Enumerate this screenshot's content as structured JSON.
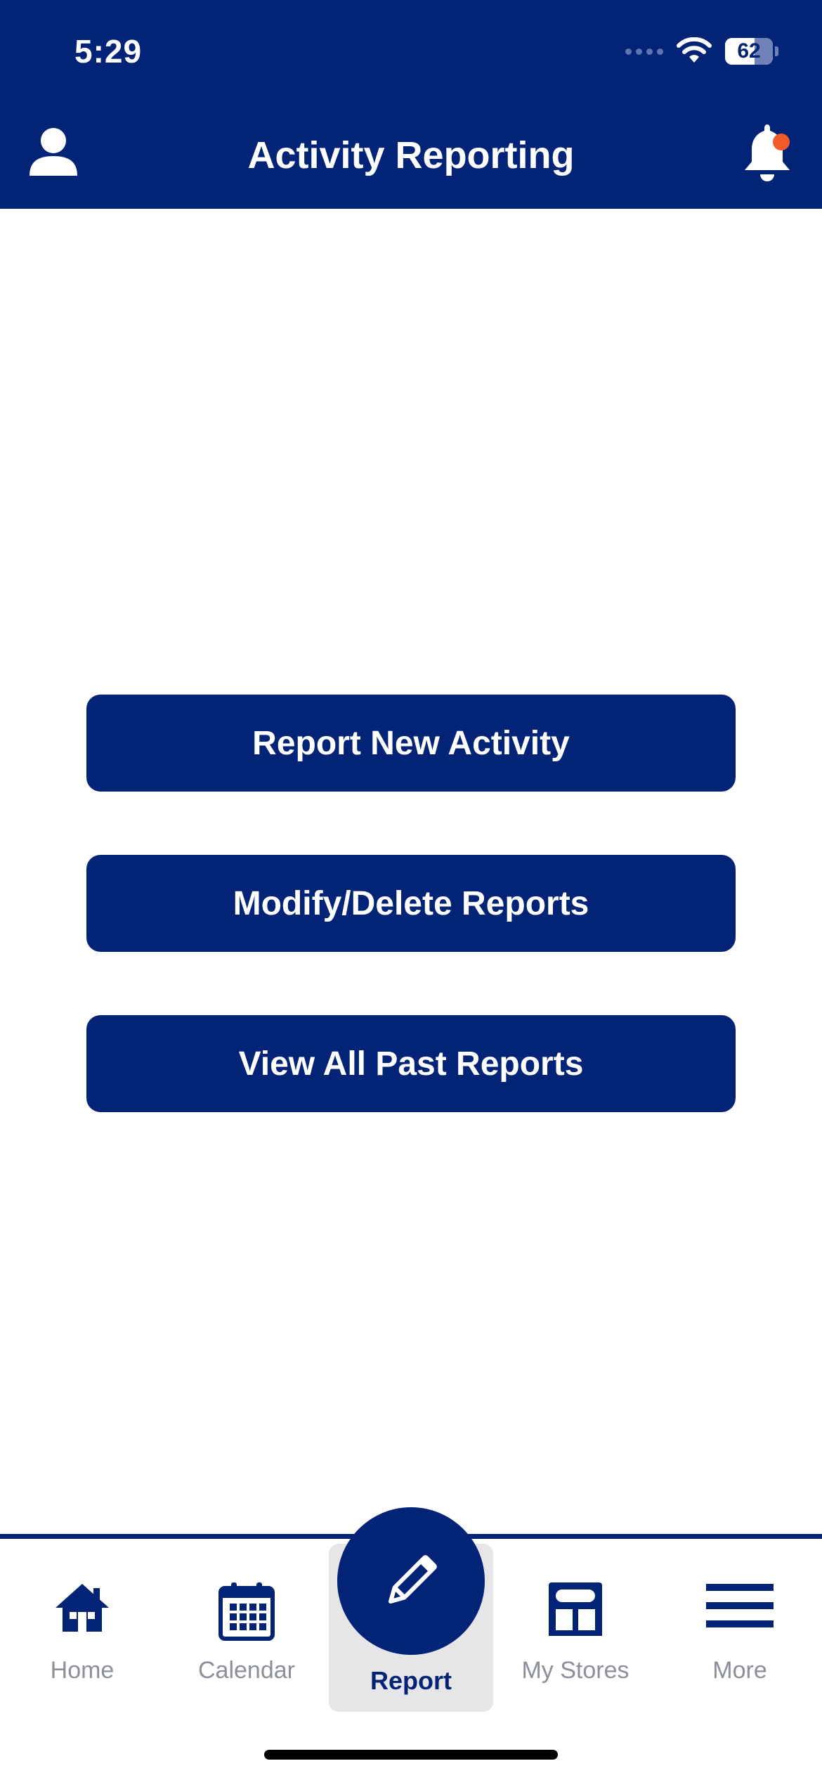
{
  "status_bar": {
    "time": "5:29",
    "battery_level": "62"
  },
  "header": {
    "title": "Activity Reporting",
    "notification_badge": true
  },
  "actions": {
    "report_new": "Report New Activity",
    "modify_delete": "Modify/Delete Reports",
    "view_past": "View All Past Reports"
  },
  "tabbar": {
    "items": [
      {
        "label": "Home",
        "icon": "home-icon"
      },
      {
        "label": "Calendar",
        "icon": "calendar-icon"
      },
      {
        "label": "Report",
        "icon": "pencil-icon",
        "active": true
      },
      {
        "label": "My Stores",
        "icon": "store-icon"
      },
      {
        "label": "More",
        "icon": "menu-icon"
      }
    ]
  },
  "colors": {
    "brand": "#032476",
    "notification": "#f25a2a",
    "tab_inactive": "#8a8f98",
    "tab_active_bg": "#e6e6e9"
  }
}
